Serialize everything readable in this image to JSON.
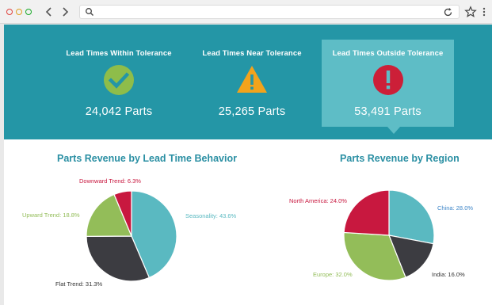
{
  "browser": {
    "address_value": "",
    "icons": [
      "back-icon",
      "forward-icon",
      "search-icon",
      "reload-icon",
      "star-icon",
      "menu-icon"
    ]
  },
  "kpis": [
    {
      "title": "Lead Times Within Tolerance",
      "value": "24,042 Parts",
      "icon": "check-icon",
      "color": "#8ebd4a"
    },
    {
      "title": "Lead Times Near Tolerance",
      "value": "25,265 Parts",
      "icon": "warning-icon",
      "color": "#f2a31c"
    },
    {
      "title": "Lead Times Outside Tolerance",
      "value": "53,491 Parts",
      "icon": "exclamation-icon",
      "color": "#cc1f38",
      "selected": true
    }
  ],
  "colors": {
    "band": "#2496a6",
    "selected_card": "#5ebdc6",
    "chart_title": "#2a8fa3"
  },
  "chart_data": [
    {
      "type": "pie",
      "title": "Parts Revenue by Lead Time Behavior",
      "categories": [
        "Seasonality",
        "Flat Trend",
        "Upward Trend",
        "Downward Trend"
      ],
      "values": [
        43.6,
        31.3,
        18.8,
        6.3
      ],
      "labels": [
        "Seasonality: 43.6%",
        "Flat Trend: 31.3%",
        "Upward Trend: 18.8%",
        "Downward Trend: 6.3%"
      ],
      "colors": [
        "#5ab9c1",
        "#3c3c41",
        "#93bd59",
        "#c8183f"
      ],
      "legend": "none"
    },
    {
      "type": "pie",
      "title": "Parts Revenue by Region",
      "categories": [
        "China",
        "India",
        "Europe",
        "North America"
      ],
      "values": [
        28.0,
        16.0,
        32.0,
        24.0
      ],
      "labels": [
        "China: 28.0%",
        "India: 16.0%",
        "Europe: 32.0%",
        "North America: 24.0%"
      ],
      "colors": [
        "#5ab9c1",
        "#3c3c41",
        "#93bd59",
        "#c8183f"
      ],
      "label_colors": [
        "#3e86c8",
        "#333333",
        "#93bd59",
        "#c8183f"
      ],
      "legend": "none"
    }
  ]
}
